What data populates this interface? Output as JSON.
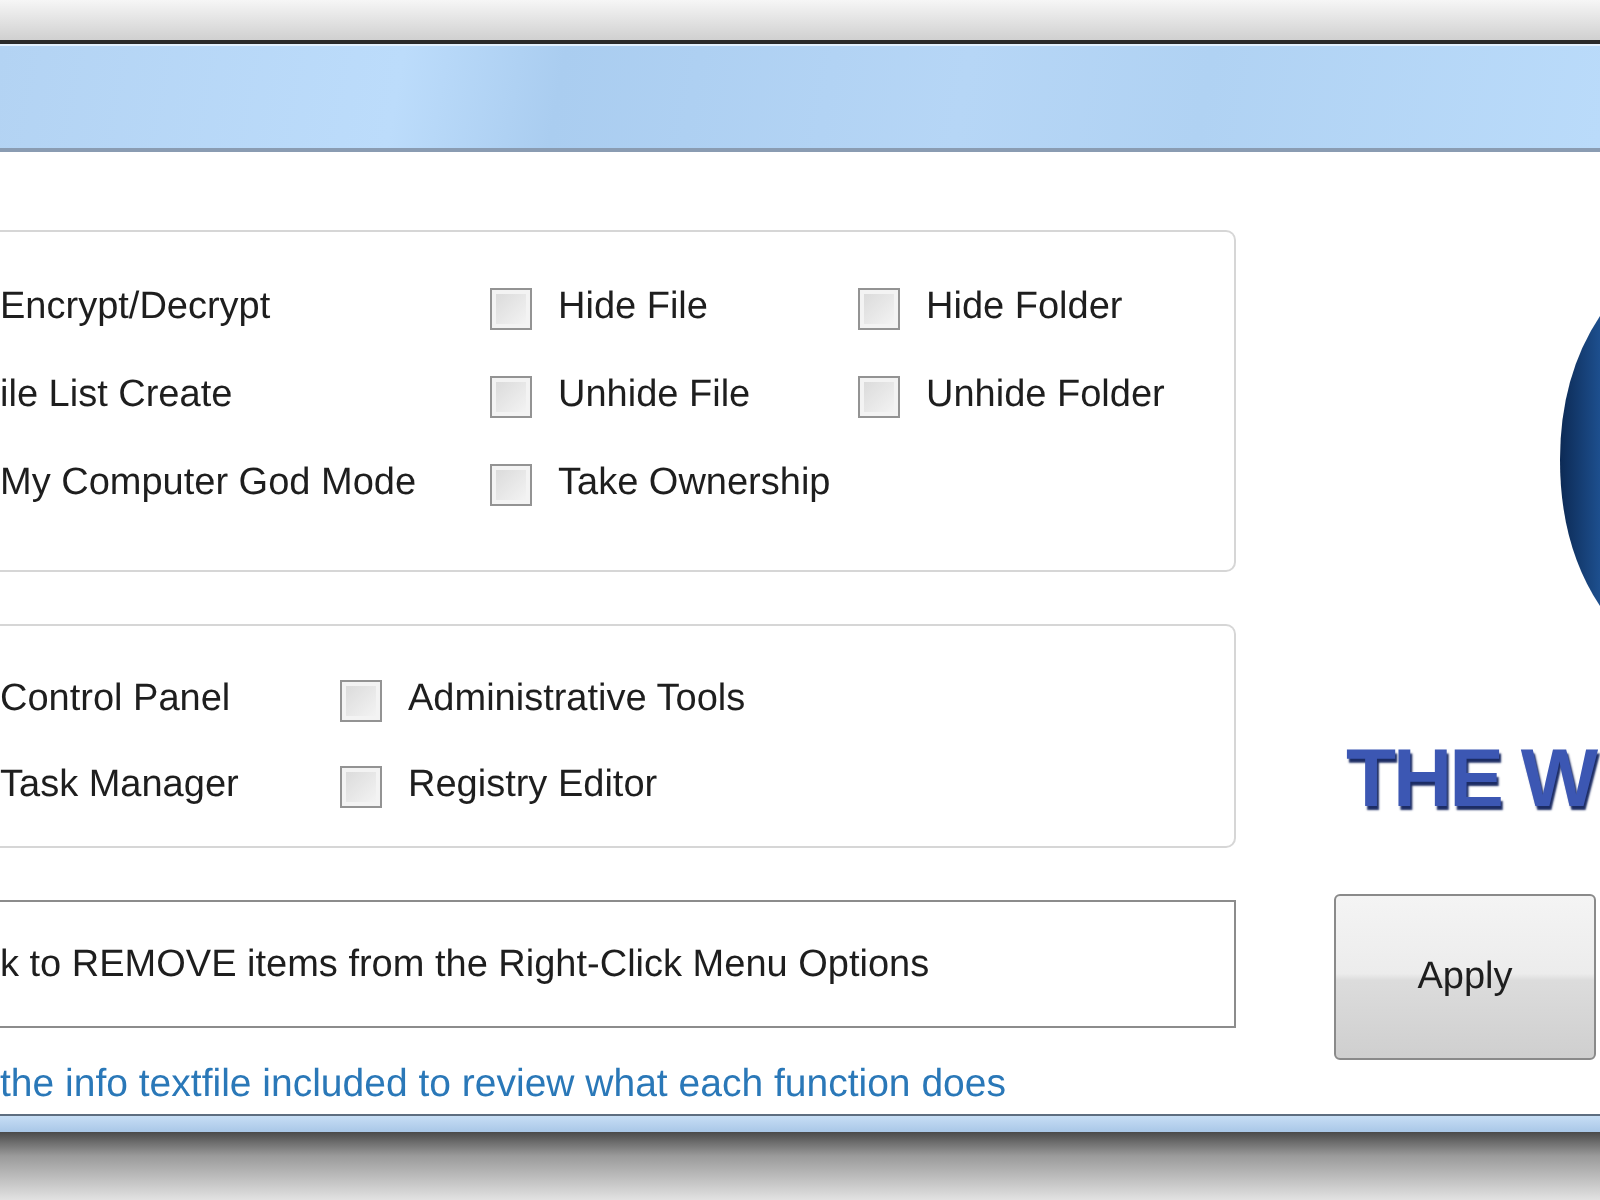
{
  "groups": [
    {
      "rows": [
        [
          {
            "label": "Encrypt/Decrypt",
            "kind": "label"
          },
          {
            "label": "Hide File",
            "kind": "checkbox",
            "checked": false
          },
          {
            "label": "Hide Folder",
            "kind": "checkbox",
            "checked": false
          }
        ],
        [
          {
            "label": "ile List Create",
            "kind": "label"
          },
          {
            "label": "Unhide File",
            "kind": "checkbox",
            "checked": false
          },
          {
            "label": "Unhide Folder",
            "kind": "checkbox",
            "checked": false
          }
        ],
        [
          {
            "label": "My Computer God Mode",
            "kind": "label"
          },
          {
            "label": "Take Ownership",
            "kind": "checkbox",
            "checked": false
          }
        ]
      ]
    },
    {
      "rows": [
        [
          {
            "label": "Control Panel",
            "kind": "label"
          },
          {
            "label": "Administrative Tools",
            "kind": "checkbox",
            "checked": false
          }
        ],
        [
          {
            "label": "Task Manager",
            "kind": "label"
          },
          {
            "label": "Registry Editor",
            "kind": "checkbox",
            "checked": false
          }
        ]
      ]
    }
  ],
  "instruction": "k to REMOVE items from the Right-Click Menu Options",
  "note": "the info textfile included to review what each function does",
  "logo": {
    "text": "THE W"
  },
  "apply_button": "Apply"
}
